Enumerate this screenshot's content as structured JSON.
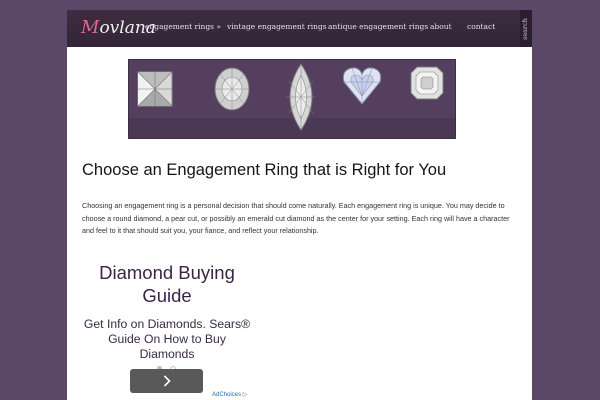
{
  "header": {
    "logo": {
      "first": "M",
      "rest": "ovlana"
    },
    "nav": [
      {
        "label": "engagement rings »"
      },
      {
        "label": "vintage engagement rings"
      },
      {
        "label": "antique engagement rings"
      },
      {
        "label": "about"
      },
      {
        "label": "contact"
      }
    ],
    "search_label": "search"
  },
  "banner": {
    "gems": [
      "princess-cut-diamond-icon",
      "round-diamond-icon",
      "marquise-diamond-icon",
      "heart-diamond-icon",
      "asscher-diamond-icon"
    ]
  },
  "article": {
    "title": "Choose an Engagement Ring that is Right for You",
    "intro": "Choosing an engagement ring is a personal decision that should come naturally. Each engagement ring is unique. You may decide to choose a round diamond, a pear cut, or possibly an emerald cut diamond as the center for your setting. Each ring will have a character and feel to it that should suit you, your fiance, and reflect your relationship."
  },
  "ad": {
    "title": "Diamond Buying Guide",
    "text": "Get Info on Diamonds. Sears® Guide On How to Buy Diamonds",
    "button_icon": "chevron-right-icon",
    "adchoices": "AdChoices"
  },
  "colors": {
    "background": "#5b4868",
    "nav": "#3a2a3c",
    "logo_accent": "#e0688c",
    "banner": "#54405e"
  }
}
